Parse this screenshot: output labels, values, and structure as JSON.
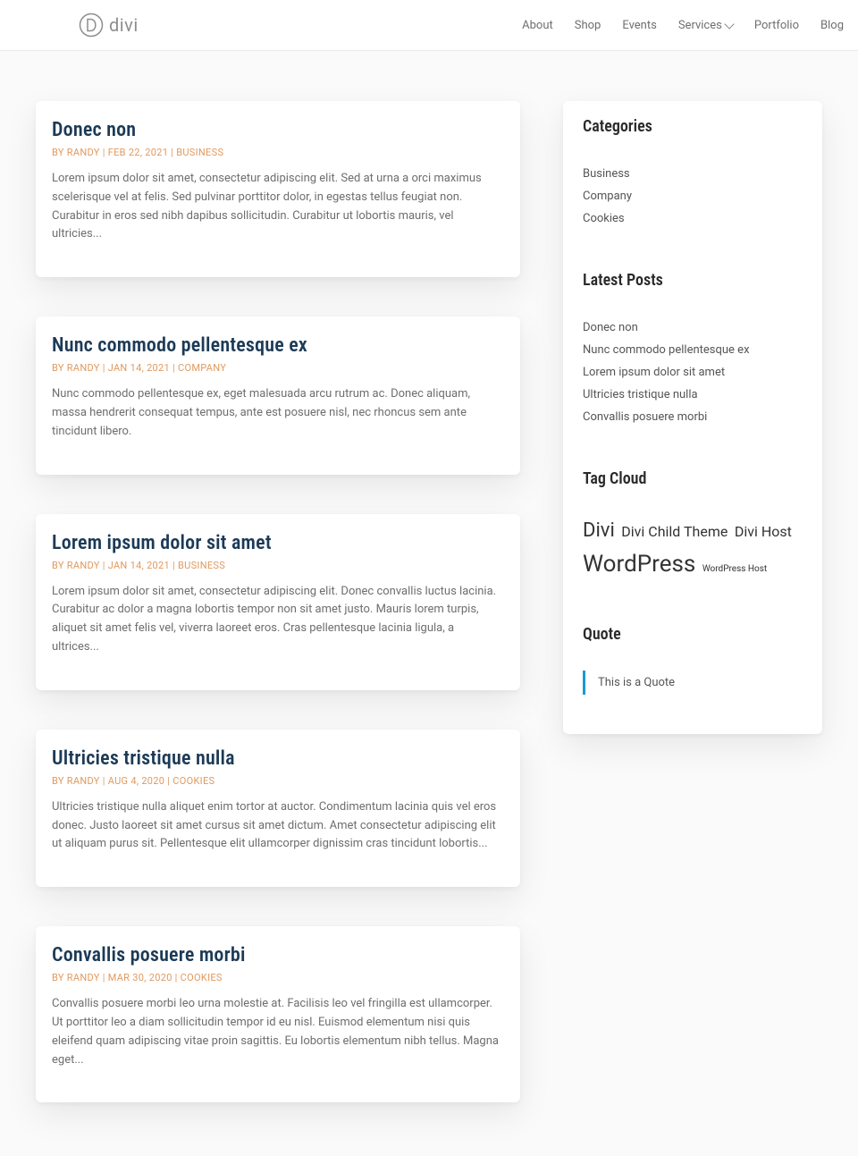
{
  "brand": {
    "name": "divi"
  },
  "nav": {
    "items": [
      {
        "label": "About",
        "has_children": false
      },
      {
        "label": "Shop",
        "has_children": false
      },
      {
        "label": "Events",
        "has_children": false
      },
      {
        "label": "Services",
        "has_children": true
      },
      {
        "label": "Portfolio",
        "has_children": false
      },
      {
        "label": "Blog",
        "has_children": false
      }
    ]
  },
  "posts": [
    {
      "title": "Donec non",
      "author": "RANDY",
      "date": "FEB 22, 2021",
      "category": "BUSINESS",
      "excerpt": "Lorem ipsum dolor sit amet, consectetur adipiscing elit. Sed at urna a orci maximus scelerisque vel at felis. Sed pulvinar porttitor dolor, in egestas tellus feugiat non. Curabitur in eros sed nibh dapibus sollicitudin. Curabitur ut lobortis mauris, vel ultricies..."
    },
    {
      "title": "Nunc commodo pellentesque ex",
      "author": "RANDY",
      "date": "JAN 14, 2021",
      "category": "COMPANY",
      "excerpt": "Nunc commodo pellentesque ex, eget malesuada arcu rutrum ac. Donec aliquam, massa hendrerit consequat tempus, ante est posuere nisl, nec rhoncus sem ante tincidunt libero."
    },
    {
      "title": "Lorem ipsum dolor sit amet",
      "author": "RANDY",
      "date": "JAN 14, 2021",
      "category": "BUSINESS",
      "excerpt": "Lorem ipsum dolor sit amet, consectetur adipiscing elit. Donec convallis luctus lacinia. Curabitur ac dolor a magna lobortis tempor non sit amet justo. Mauris lorem turpis, aliquet sit amet felis vel, viverra laoreet eros. Cras pellentesque lacinia ligula, a ultrices..."
    },
    {
      "title": "Ultricies tristique nulla",
      "author": "RANDY",
      "date": "AUG 4, 2020",
      "category": "COOKIES",
      "excerpt": "Ultricies tristique nulla aliquet enim tortor at auctor. Condimentum lacinia quis vel eros donec. Justo laoreet sit amet cursus sit amet dictum. Amet consectetur adipiscing elit ut aliquam purus sit. Pellentesque elit ullamcorper dignissim cras tincidunt lobortis..."
    },
    {
      "title": "Convallis posuere morbi",
      "author": "RANDY",
      "date": "MAR 30, 2020",
      "category": "COOKIES",
      "excerpt": "Convallis posuere morbi leo urna molestie at. Facilisis leo vel fringilla est ullamcorper. Ut porttitor leo a diam sollicitudin tempor id eu nisl. Euismod elementum nisi quis eleifend quam adipiscing vitae proin sagittis. Eu lobortis elementum nibh tellus. Magna eget..."
    }
  ],
  "sidebar": {
    "categories": {
      "title": "Categories",
      "items": [
        "Business",
        "Company",
        "Cookies"
      ]
    },
    "latest": {
      "title": "Latest Posts",
      "items": [
        "Donec non",
        "Nunc commodo pellentesque ex",
        "Lorem ipsum dolor sit amet",
        "Ultricies tristique nulla",
        "Convallis posuere morbi"
      ]
    },
    "tagcloud": {
      "title": "Tag Cloud",
      "tags": [
        {
          "label": "Divi",
          "size": 22
        },
        {
          "label": "Divi Child Theme",
          "size": 16
        },
        {
          "label": "Divi Host",
          "size": 16
        },
        {
          "label": "WordPress",
          "size": 26
        },
        {
          "label": "WordPress Host",
          "size": 10
        }
      ]
    },
    "quote": {
      "title": "Quote",
      "text": "This is a Quote"
    }
  },
  "meta_labels": {
    "by": "BY"
  }
}
